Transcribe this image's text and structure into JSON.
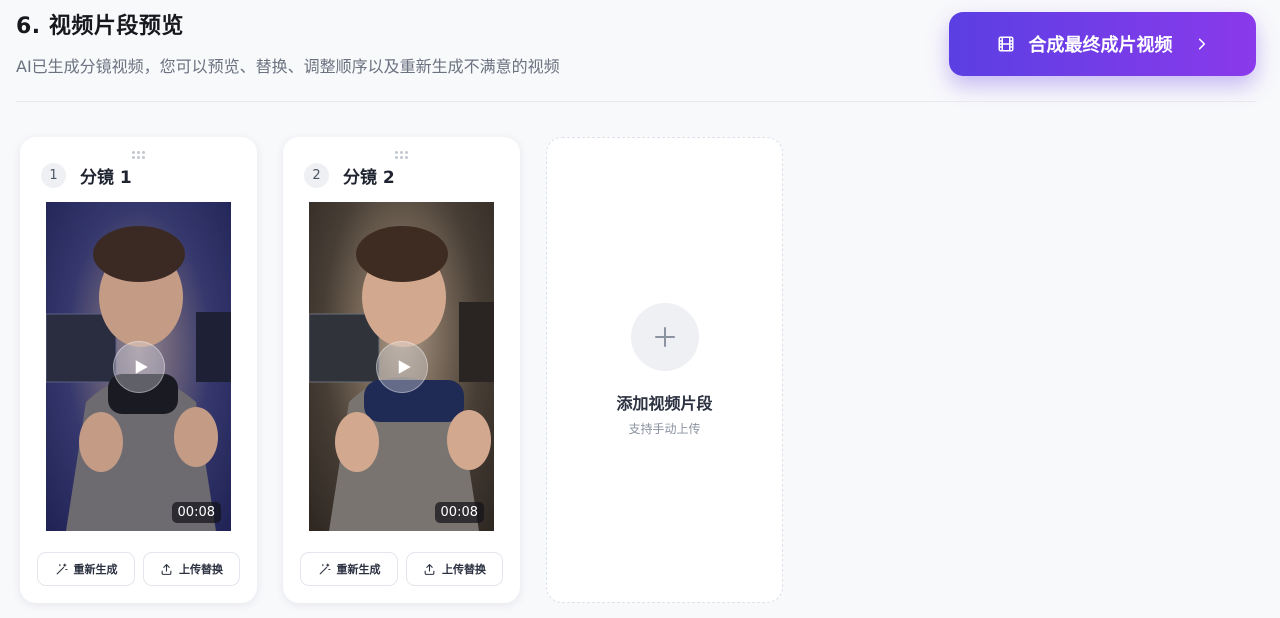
{
  "header": {
    "title": "6. 视频片段预览",
    "subtitle": "AI已生成分镜视频，您可以预览、替换、调整顺序以及重新生成不满意的视频",
    "compose_button": {
      "label": "合成最终成片视频",
      "icon": "film-icon",
      "trailing_icon": "chevron-right-icon"
    }
  },
  "segments": [
    {
      "index": "1",
      "title": "分镜 1",
      "duration": "00:08",
      "regenerate_label": "重新生成",
      "upload_label": "上传替换"
    },
    {
      "index": "2",
      "title": "分镜 2",
      "duration": "00:08",
      "regenerate_label": "重新生成",
      "upload_label": "上传替换"
    }
  ],
  "add_card": {
    "title": "添加视频片段",
    "subtitle": "支持手动上传"
  },
  "colors": {
    "accent_start": "#5b3fe3",
    "accent_end": "#8a3aeb",
    "background": "#f8f9fb"
  }
}
